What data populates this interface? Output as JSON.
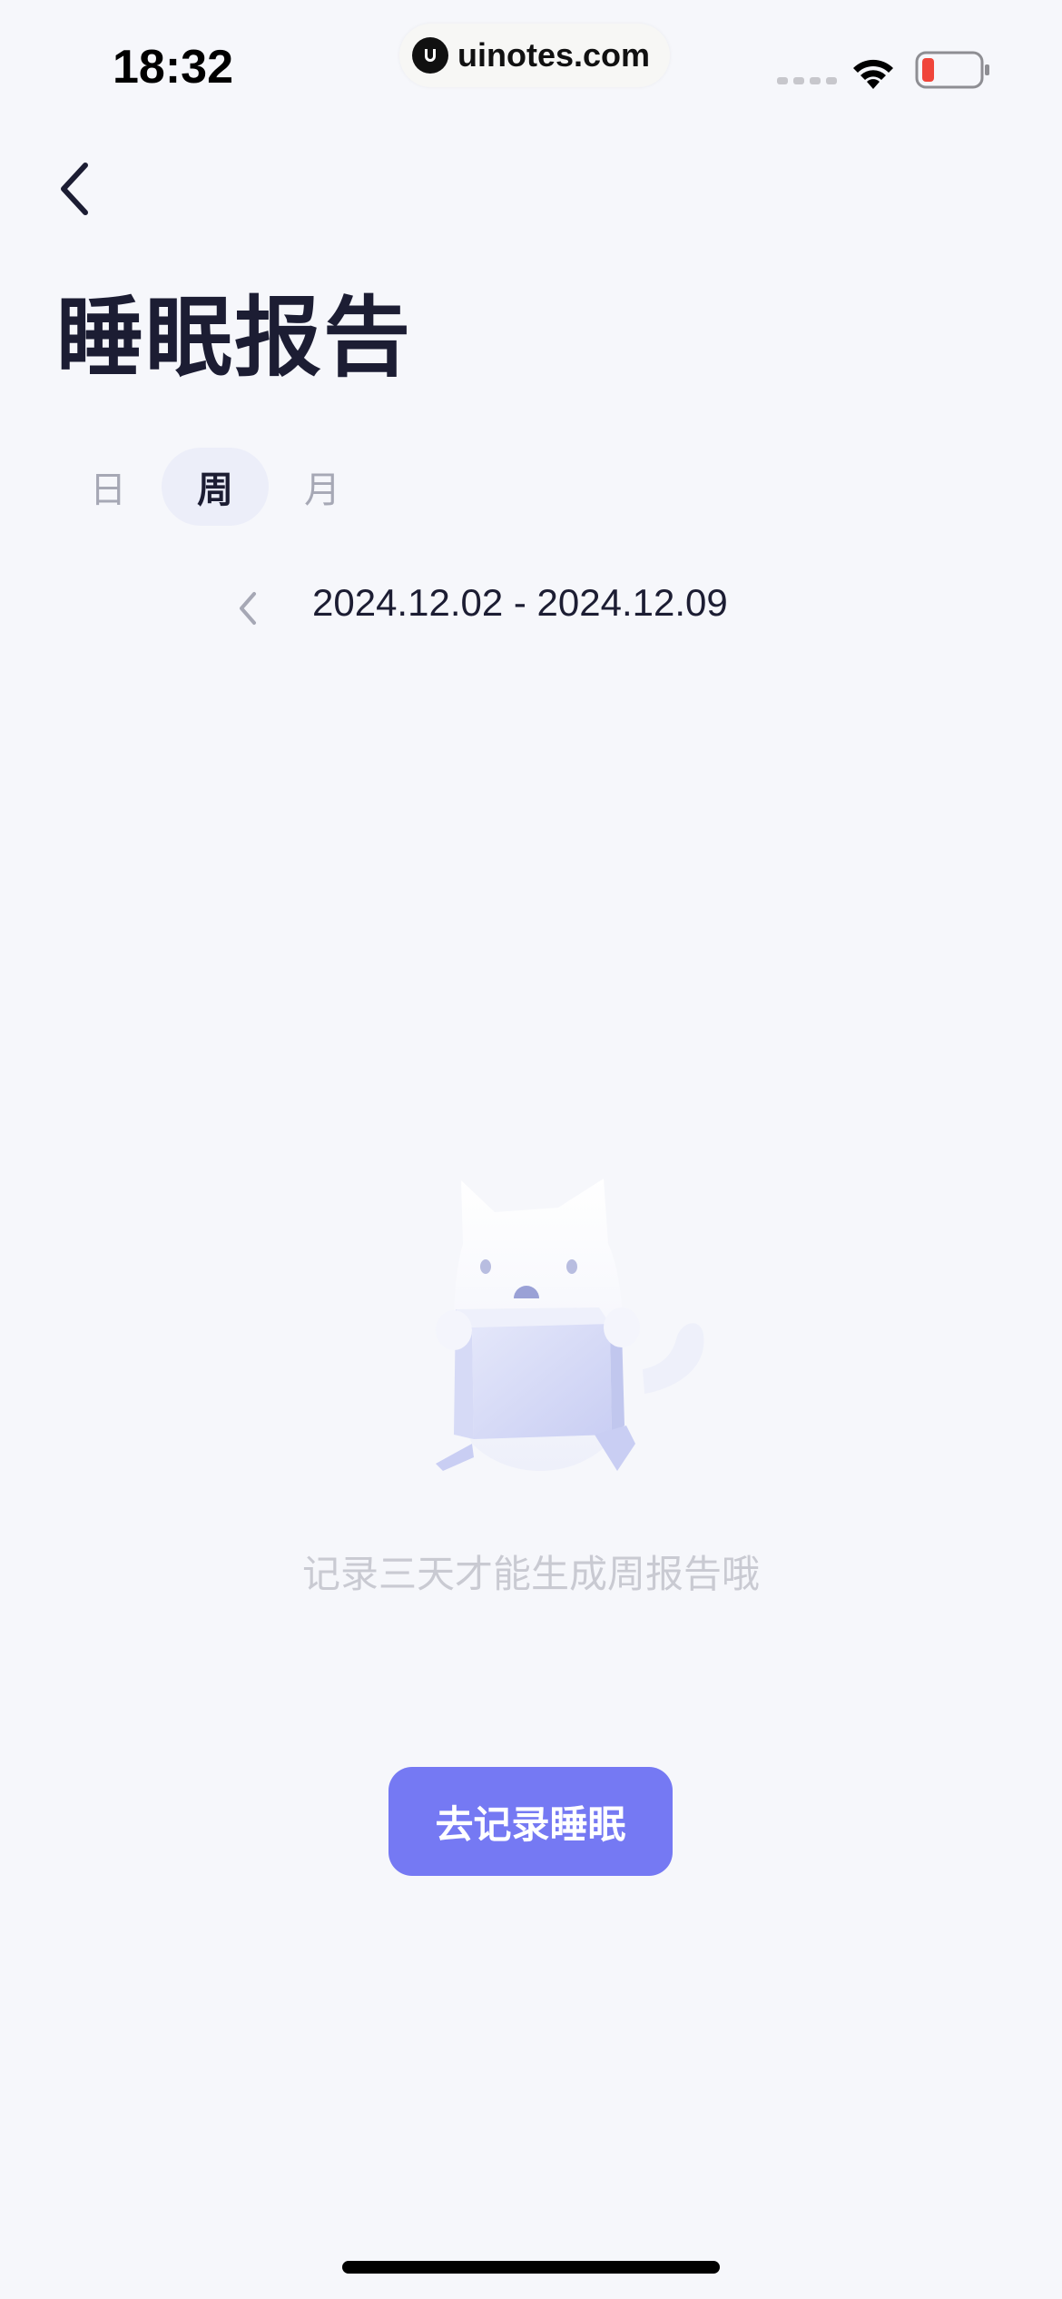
{
  "status_bar": {
    "time": "18:32",
    "watermark": "uinotes.com",
    "icons": [
      "cellular-signal-icon",
      "wifi-icon",
      "battery-low-icon"
    ],
    "battery_color": "#f0453a"
  },
  "header": {
    "back_icon": "chevron-left-icon",
    "title": "睡眠报告"
  },
  "tabs": [
    {
      "label": "日",
      "active": false
    },
    {
      "label": "周",
      "active": true
    },
    {
      "label": "月",
      "active": false
    }
  ],
  "date_range": {
    "prev_icon": "chevron-left-icon",
    "text": "2024.12.02 - 2024.12.09"
  },
  "empty_state": {
    "illustration": "cat-holding-box-illustration",
    "message": "记录三天才能生成周报告哦"
  },
  "cta": {
    "label": "去记录睡眠",
    "color": "#7579f3"
  },
  "colors": {
    "background": "#f6f7fb",
    "title": "#1c1d33",
    "tab_active_bg": "#eceef9",
    "muted_text": "#c9cad2"
  }
}
